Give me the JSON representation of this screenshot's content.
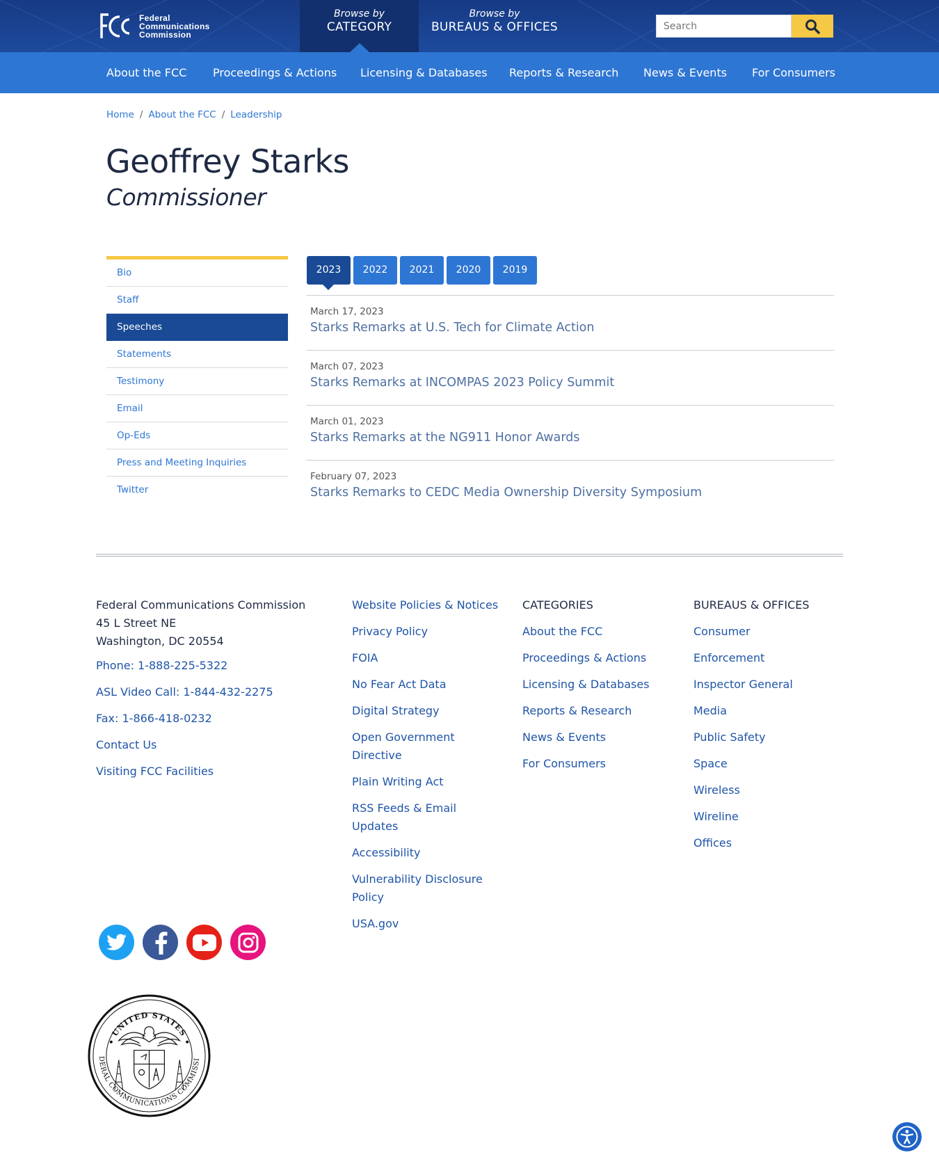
{
  "header": {
    "logo": {
      "line1": "Federal",
      "line2": "Communications",
      "line3": "Commission"
    },
    "browse_category": {
      "small": "Browse by",
      "big": "CATEGORY"
    },
    "browse_bureaus": {
      "small": "Browse by",
      "big": "BUREAUS & OFFICES"
    },
    "search": {
      "placeholder": "Search",
      "icon": "search-icon"
    }
  },
  "nav": [
    "About the FCC",
    "Proceedings & Actions",
    "Licensing & Databases",
    "Reports & Research",
    "News & Events",
    "For Consumers"
  ],
  "breadcrumb": [
    "Home",
    "About the FCC",
    "Leadership"
  ],
  "page": {
    "title": "Geoffrey Starks",
    "subtitle": "Commissioner"
  },
  "sidebar": {
    "items": [
      "Bio",
      "Staff",
      "Speeches",
      "Statements",
      "Testimony",
      "Email",
      "Op-Eds",
      "Press and Meeting Inquiries",
      "Twitter"
    ],
    "active": "Speeches"
  },
  "year_tabs": {
    "items": [
      "2023",
      "2022",
      "2021",
      "2020",
      "2019"
    ],
    "active": "2023"
  },
  "speeches": [
    {
      "date": "March 17, 2023",
      "title": "Starks Remarks at U.S. Tech for Climate Action"
    },
    {
      "date": "March 07, 2023",
      "title": "Starks Remarks at INCOMPAS 2023 Policy Summit"
    },
    {
      "date": "March 01, 2023",
      "title": "Starks Remarks at the NG911 Honor Awards"
    },
    {
      "date": "February 07, 2023",
      "title": "Starks Remarks to CEDC Media Ownership Diversity Symposium"
    }
  ],
  "footer": {
    "address": [
      "Federal Communications Commission",
      "45 L Street NE",
      "Washington, DC 20554"
    ],
    "contact_links": [
      "Phone: 1-888-225-5322",
      "ASL Video Call: 1-844-432-2275",
      "Fax: 1-866-418-0232",
      "Contact Us",
      "Visiting FCC Facilities"
    ],
    "policy_links": [
      "Website Policies & Notices",
      "Privacy Policy",
      "FOIA",
      "No Fear Act Data",
      "Digital Strategy",
      "Open Government Directive",
      "Plain Writing Act",
      "RSS Feeds & Email Updates",
      "Accessibility",
      "Vulnerability Disclosure Policy",
      "USA.gov"
    ],
    "categories": {
      "heading": "CATEGORIES",
      "items": [
        "About the FCC",
        "Proceedings & Actions",
        "Licensing & Databases",
        "Reports & Research",
        "News & Events",
        "For Consumers"
      ]
    },
    "bureaus": {
      "heading": "BUREAUS & OFFICES",
      "items": [
        "Consumer",
        "Enforcement",
        "Inspector General",
        "Media",
        "Public Safety",
        "Space",
        "Wireless",
        "Wireline",
        "Offices"
      ]
    },
    "social": [
      {
        "name": "twitter-icon",
        "color": "#1da1f2"
      },
      {
        "name": "facebook-icon",
        "color": "#3b5998"
      },
      {
        "name": "youtube-icon",
        "color": "#e62117"
      },
      {
        "name": "instagram-icon",
        "color": "#e6147c"
      }
    ],
    "seal": {
      "text": "FEDERAL COMMUNICATIONS COMMISSION",
      "top_text": "UNITED STATES"
    }
  },
  "colors": {
    "header_dark": "#173a84",
    "nav_blue": "#2e76d3",
    "active_blue": "#1a4a95",
    "accent_yellow": "#f5c845",
    "link_blue": "#1f55a8"
  }
}
